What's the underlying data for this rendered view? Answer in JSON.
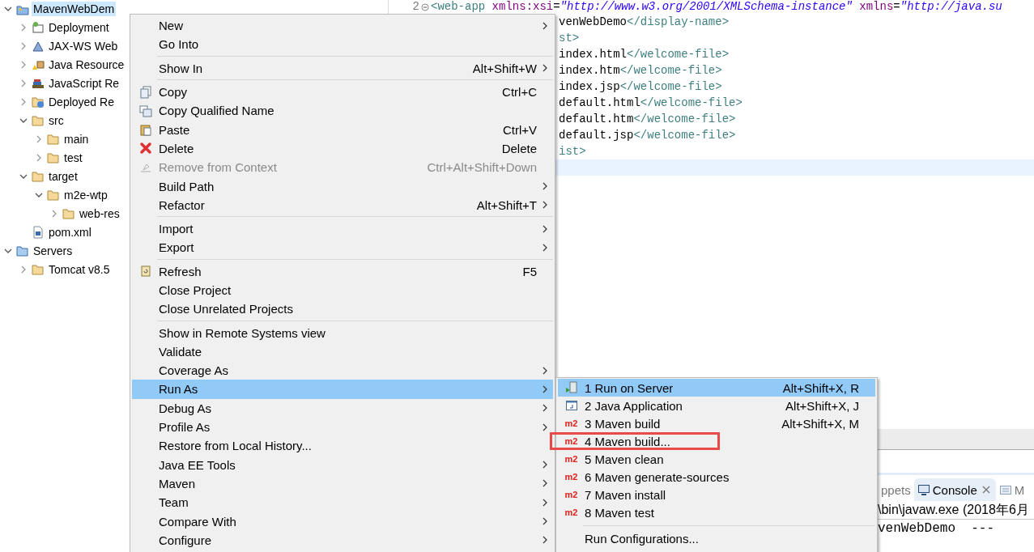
{
  "tree": {
    "items": [
      {
        "label": "MavenWebDem",
        "kind": "project",
        "expanded": true,
        "selected": true,
        "children": [
          {
            "label": "Deployment",
            "kind": "descriptor",
            "expanded": false,
            "selected": false
          },
          {
            "label": "JAX-WS Web",
            "kind": "webservice",
            "expanded": false,
            "selected": false
          },
          {
            "label": "Java Resource",
            "kind": "resources",
            "expanded": false,
            "selected": false
          },
          {
            "label": "JavaScript Re",
            "kind": "library",
            "expanded": false,
            "selected": false
          },
          {
            "label": "Deployed Re",
            "kind": "deployed",
            "expanded": false,
            "selected": false
          },
          {
            "label": "src",
            "kind": "folder",
            "expanded": true,
            "selected": false,
            "children": [
              {
                "label": "main",
                "kind": "folder",
                "expanded": false,
                "selected": false
              },
              {
                "label": "test",
                "kind": "folder",
                "expanded": false,
                "selected": false
              }
            ]
          },
          {
            "label": "target",
            "kind": "folder",
            "expanded": true,
            "selected": false,
            "children": [
              {
                "label": "m2e-wtp",
                "kind": "folder",
                "expanded": true,
                "selected": false,
                "children": [
                  {
                    "label": "web-res",
                    "kind": "folder",
                    "expanded": false,
                    "selected": false
                  }
                ]
              }
            ]
          },
          {
            "label": "pom.xml",
            "kind": "pom",
            "selected": false
          }
        ]
      },
      {
        "label": "Servers",
        "kind": "server-folder",
        "expanded": true,
        "selected": false,
        "children": [
          {
            "label": "Tomcat v8.5",
            "kind": "folder",
            "expanded": false,
            "selected": false
          }
        ]
      }
    ]
  },
  "editor": {
    "lines": [
      {
        "number": "2",
        "segments": [
          {
            "kind": "tag",
            "text": "<web-app"
          },
          {
            "kind": "attr",
            "text": " xmlns:xsi"
          },
          {
            "kind": "plain",
            "text": "="
          },
          {
            "kind": "value",
            "text": "\"http://www.w3.org/2001/XMLSchema-instance\""
          },
          {
            "kind": "attr",
            "text": " xmlns"
          },
          {
            "kind": "plain",
            "text": "="
          },
          {
            "kind": "value",
            "text": "\"http://java.su"
          }
        ]
      },
      {
        "segments": [
          {
            "kind": "plain",
            "text": "venWebDemo"
          },
          {
            "kind": "tag",
            "text": "</display-name>"
          }
        ]
      },
      {
        "segments": [
          {
            "kind": "tag",
            "text": "st>"
          }
        ]
      },
      {
        "segments": [
          {
            "kind": "plain",
            "text": "index.html"
          },
          {
            "kind": "tag",
            "text": "</welcome-file>"
          }
        ]
      },
      {
        "segments": [
          {
            "kind": "plain",
            "text": "index.htm"
          },
          {
            "kind": "tag",
            "text": "</welcome-file>"
          }
        ]
      },
      {
        "segments": [
          {
            "kind": "plain",
            "text": "index.jsp"
          },
          {
            "kind": "tag",
            "text": "</welcome-file>"
          }
        ]
      },
      {
        "segments": [
          {
            "kind": "plain",
            "text": "default.html"
          },
          {
            "kind": "tag",
            "text": "</welcome-file>"
          }
        ]
      },
      {
        "segments": [
          {
            "kind": "plain",
            "text": "default.htm"
          },
          {
            "kind": "tag",
            "text": "</welcome-file>"
          }
        ]
      },
      {
        "segments": [
          {
            "kind": "plain",
            "text": "default.jsp"
          },
          {
            "kind": "tag",
            "text": "</welcome-file>"
          }
        ]
      },
      {
        "segments": [
          {
            "kind": "tag",
            "text": "ist>"
          }
        ]
      },
      {
        "current": true
      }
    ]
  },
  "bottom_panel": {
    "tabs": [
      {
        "label": "ppets",
        "kind": "plain",
        "selected": false
      },
      {
        "label": "Console",
        "kind": "console",
        "selected": true,
        "closable": true
      },
      {
        "label": "M",
        "kind": "list",
        "selected": false
      }
    ],
    "console_lines": [
      "\\bin\\javaw.exe (2018年6月",
      "venWebDemo  ---"
    ]
  },
  "context_menu": {
    "items": [
      {
        "kind": "plain",
        "label": "New",
        "submenu": true,
        "selected": false
      },
      {
        "kind": "plain",
        "label": "Go Into",
        "selected": false
      },
      {
        "kind": "separator"
      },
      {
        "kind": "plain",
        "label": "Show In",
        "shortcut": "Alt+Shift+W",
        "submenu": true,
        "selected": false
      },
      {
        "kind": "separator"
      },
      {
        "kind": "copy",
        "label": "Copy",
        "shortcut": "Ctrl+C",
        "selected": false
      },
      {
        "kind": "copy-qualified",
        "label": "Copy Qualified Name",
        "selected": false
      },
      {
        "kind": "paste",
        "label": "Paste",
        "shortcut": "Ctrl+V",
        "selected": false
      },
      {
        "kind": "delete",
        "label": "Delete",
        "shortcut": "Delete",
        "selected": false
      },
      {
        "kind": "remove",
        "label": "Remove from Context",
        "shortcut": "Ctrl+Alt+Shift+Down",
        "disabled": true,
        "selected": false
      },
      {
        "kind": "plain",
        "label": "Build Path",
        "submenu": true,
        "selected": false
      },
      {
        "kind": "plain",
        "label": "Refactor",
        "shortcut": "Alt+Shift+T",
        "submenu": true,
        "selected": false
      },
      {
        "kind": "separator"
      },
      {
        "kind": "plain",
        "label": "Import",
        "submenu": true,
        "selected": false
      },
      {
        "kind": "plain",
        "label": "Export",
        "submenu": true,
        "selected": false
      },
      {
        "kind": "separator"
      },
      {
        "kind": "refresh",
        "label": "Refresh",
        "shortcut": "F5",
        "selected": false
      },
      {
        "kind": "plain",
        "label": "Close Project",
        "selected": false
      },
      {
        "kind": "plain",
        "label": "Close Unrelated Projects",
        "selected": false
      },
      {
        "kind": "separator"
      },
      {
        "kind": "plain",
        "label": "Show in Remote Systems view",
        "selected": false
      },
      {
        "kind": "plain",
        "label": "Validate",
        "selected": false
      },
      {
        "kind": "plain",
        "label": "Coverage As",
        "submenu": true,
        "selected": false
      },
      {
        "kind": "plain",
        "label": "Run As",
        "submenu": true,
        "selected": true
      },
      {
        "kind": "plain",
        "label": "Debug As",
        "submenu": true,
        "selected": false
      },
      {
        "kind": "plain",
        "label": "Profile As",
        "submenu": true,
        "selected": false
      },
      {
        "kind": "plain",
        "label": "Restore from Local History...",
        "selected": false
      },
      {
        "kind": "plain",
        "label": "Java EE Tools",
        "submenu": true,
        "selected": false
      },
      {
        "kind": "plain",
        "label": "Maven",
        "submenu": true,
        "selected": false
      },
      {
        "kind": "plain",
        "label": "Team",
        "submenu": true,
        "selected": false
      },
      {
        "kind": "plain",
        "label": "Compare With",
        "submenu": true,
        "selected": false
      },
      {
        "kind": "plain",
        "label": "Configure",
        "submenu": true,
        "selected": false
      }
    ]
  },
  "run_as_menu": {
    "items": [
      {
        "kind": "server",
        "label": "1 Run on Server",
        "shortcut": "Alt+Shift+X, R",
        "selected": true,
        "annotated": false
      },
      {
        "kind": "java",
        "label": "2 Java Application",
        "shortcut": "Alt+Shift+X, J",
        "selected": false,
        "annotated": false
      },
      {
        "kind": "maven",
        "badge": "m2",
        "label": "3 Maven build",
        "shortcut": "Alt+Shift+X, M",
        "selected": false,
        "annotated": false
      },
      {
        "kind": "maven",
        "badge": "m2",
        "label": "4 Maven build...",
        "selected": false,
        "annotated": true
      },
      {
        "kind": "maven",
        "badge": "m2",
        "label": "5 Maven clean",
        "selected": false,
        "annotated": false
      },
      {
        "kind": "maven",
        "badge": "m2",
        "label": "6 Maven generate-sources",
        "selected": false,
        "annotated": false
      },
      {
        "kind": "maven",
        "badge": "m2",
        "label": "7 Maven install",
        "selected": false,
        "annotated": false
      },
      {
        "kind": "maven",
        "badge": "m2",
        "label": "8 Maven test",
        "selected": false,
        "annotated": false
      },
      {
        "kind": "separator"
      },
      {
        "kind": "plain",
        "label": "Run Configurations...",
        "selected": false,
        "annotated": false
      }
    ]
  }
}
